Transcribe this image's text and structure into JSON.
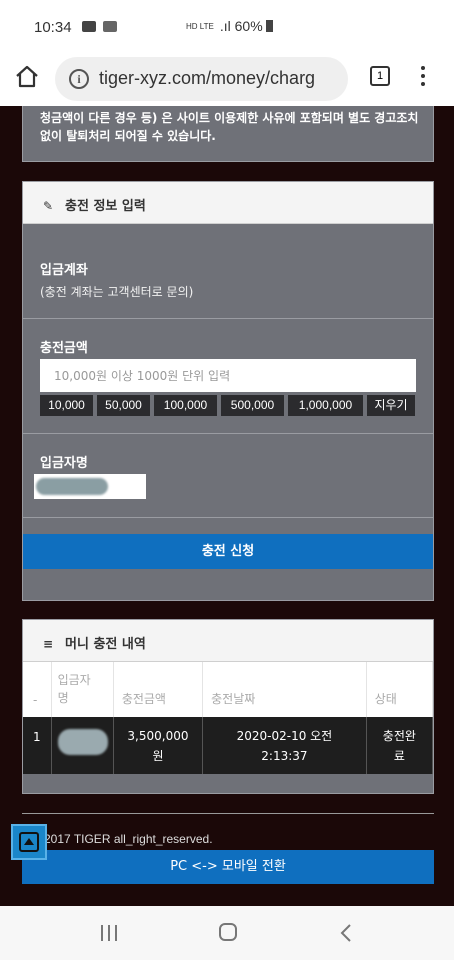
{
  "status_bar": {
    "time": "10:34",
    "network": "HD LTE",
    "battery": "60%"
  },
  "browser": {
    "url": "tiger-xyz.com/money/charg",
    "tab_count": "1"
  },
  "notice": {
    "text": "청금액이 다른 경우 등) 은 사이트 이용제한 사유에 포함되며 별도 경고조치 없이 탈퇴처리 되어질 수 있습니다."
  },
  "charge_form": {
    "title": "충전 정보 입력",
    "account_label": "입금계좌",
    "account_note": "(충전 계좌는 고객센터로 문의)",
    "amount_label": "충전금액",
    "amount_placeholder": "10,000원 이상 1000원 단위 입력",
    "quick_amounts": [
      "10,000",
      "50,000",
      "100,000",
      "500,000",
      "1,000,000"
    ],
    "clear_label": "지우기",
    "depositor_label": "입금자명",
    "submit_label": "충전 신청"
  },
  "history": {
    "title": "머니 충전 내역",
    "columns": [
      "-",
      "입금자명",
      "충전금액",
      "충전날짜",
      "상태"
    ],
    "rows": [
      {
        "no": "1",
        "amount": "3,500,000원",
        "date": "2020-02-10 오전 2:13:37",
        "status": "충전완료"
      }
    ]
  },
  "footer": {
    "copyright": "2017 TIGER all_right_reserved.",
    "switch_label": "PC <-> 모바일 전환"
  }
}
